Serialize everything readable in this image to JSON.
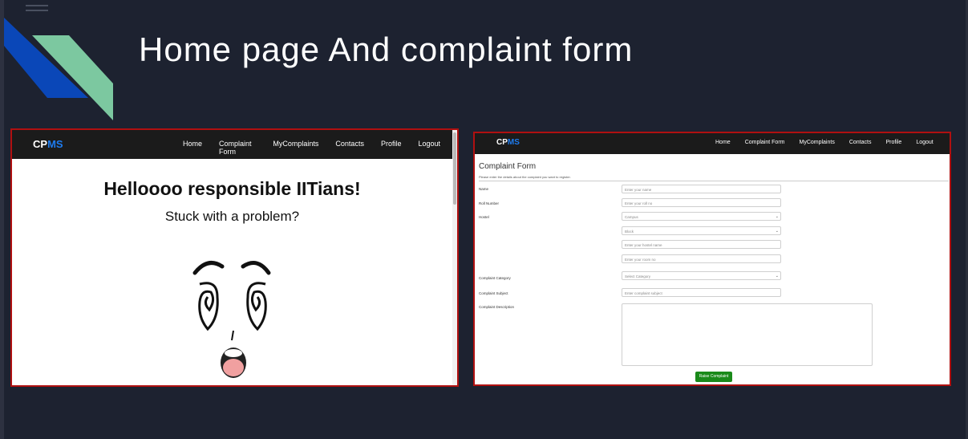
{
  "slide": {
    "title": "Home page  And complaint form"
  },
  "homepage": {
    "brand_cp": "CP",
    "brand_ms": "MS",
    "nav": [
      "Home",
      "Complaint Form",
      "MyComplaints",
      "Contacts",
      "Profile",
      "Logout"
    ],
    "headline": "Helloooo responsible IITians!",
    "subheadline": "Stuck with a problem?"
  },
  "complaint_page": {
    "brand_cp": "CP",
    "brand_ms": "MS",
    "nav": [
      "Home",
      "Complaint Form",
      "MyComplaints",
      "Contacts",
      "Profile",
      "Logout"
    ],
    "form": {
      "title": "Complaint Form",
      "subtitle": "Please enter the details about the complaint you want to register.",
      "labels": {
        "name": "Name",
        "roll": "Roll Number",
        "hostel": "Hostel",
        "category": "Complaint Category",
        "subject": "Complaint Subject",
        "description": "Complaint Description"
      },
      "placeholders": {
        "name": "Enter your name",
        "roll": "Enter your roll no",
        "campus": "Campus",
        "block": "Block",
        "hostel_name": "Enter your hostel name",
        "room": "Enter your room no",
        "category": "Select Category",
        "subject": "Enter complaint subject"
      },
      "submit_label": "Raise Complaint"
    }
  },
  "colors": {
    "slide_bg": "#1d2230",
    "frame_border": "#b01010",
    "brand_accent": "#1e7cf0",
    "submit": "#1a8a1a",
    "deco_blue": "#0a47b8",
    "deco_green": "#7cc8a0"
  }
}
